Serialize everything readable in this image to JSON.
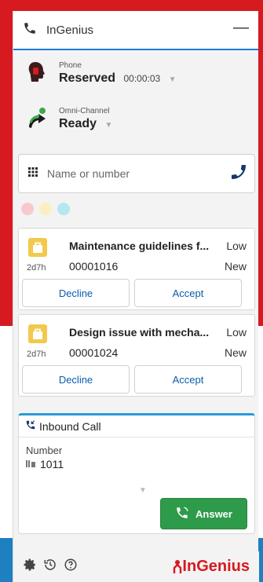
{
  "header": {
    "title": "InGenius",
    "minimize": "—"
  },
  "phone": {
    "label": "Phone",
    "status": "Reserved",
    "timer": "00:00:03"
  },
  "omni": {
    "label": "Omni-Channel",
    "status": "Ready"
  },
  "dial": {
    "placeholder": "Name or number"
  },
  "status_dots": [
    "#f8c9cc",
    "#fbefbf",
    "#b3e9ee"
  ],
  "work_items": [
    {
      "age": "2d7h",
      "subject": "Maintenance guidelines f...",
      "priority": "Low",
      "number": "00001016",
      "state": "New",
      "decline": "Decline",
      "accept": "Accept"
    },
    {
      "age": "2d7h",
      "subject": "Design issue with mecha...",
      "priority": "Low",
      "number": "00001024",
      "state": "New",
      "decline": "Decline",
      "accept": "Accept"
    }
  ],
  "inbound": {
    "title": "Inbound Call",
    "number_label": "Number",
    "number": "1011",
    "answer": "Answer"
  },
  "footer": {
    "brand": "InGenius"
  },
  "colors": {
    "brand_red": "#d71920",
    "accent_blue": "#1f7ae0",
    "answer_green": "#2e9b4a",
    "bag_yellow": "#f2c94c"
  }
}
